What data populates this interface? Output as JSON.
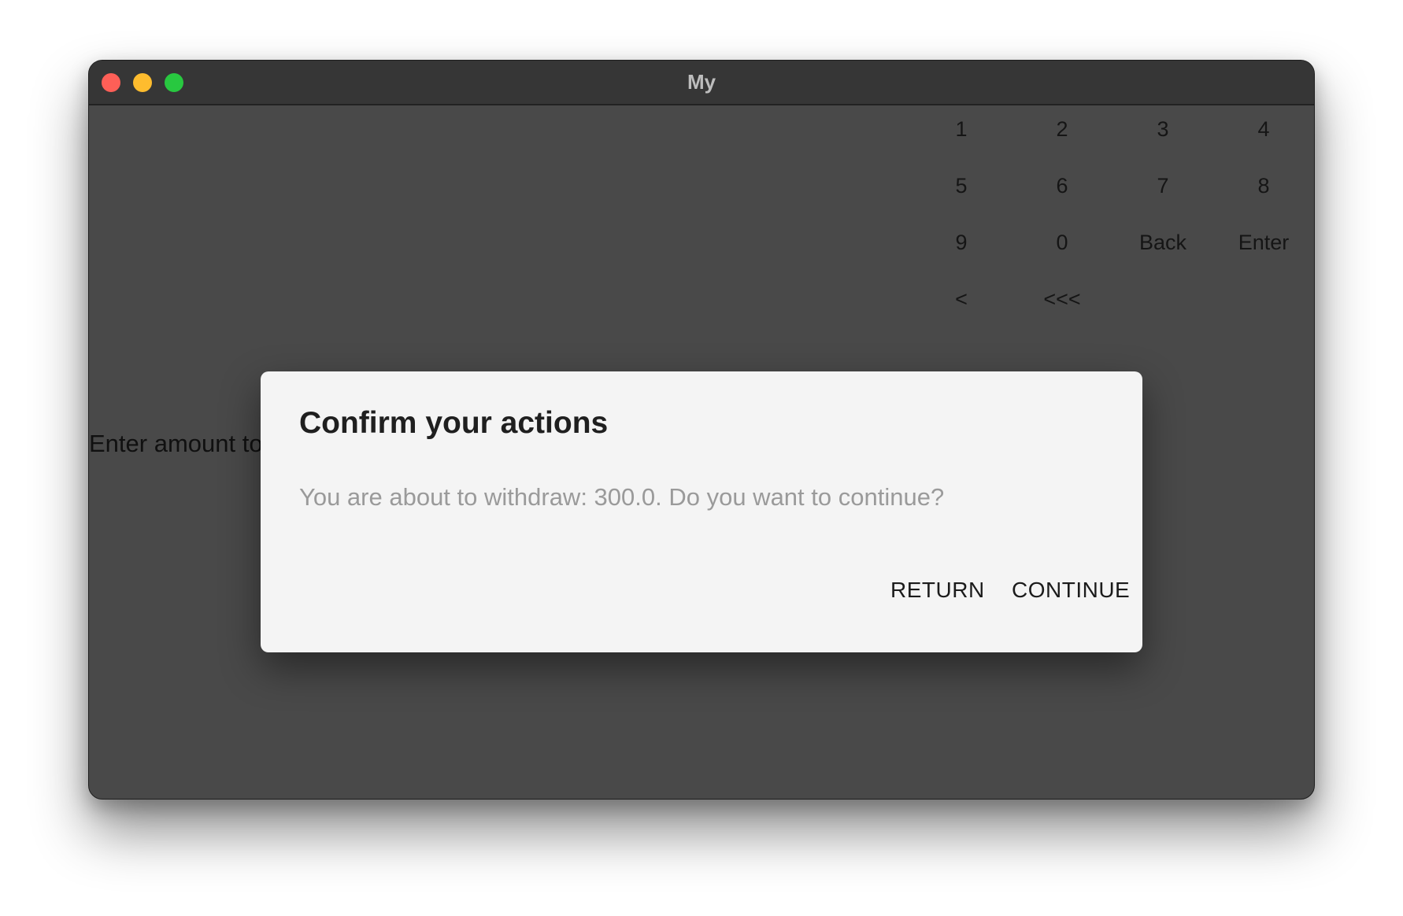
{
  "window": {
    "title": "My"
  },
  "keypad": {
    "keys": [
      "1",
      "2",
      "3",
      "4",
      "5",
      "6",
      "7",
      "8",
      "9",
      "0",
      "Back",
      "Enter",
      "<",
      "<<<"
    ]
  },
  "main": {
    "prompt": "Enter amount to"
  },
  "dialog": {
    "title": "Confirm your actions",
    "message": "You are about to withdraw: 300.0. Do you want to continue?",
    "return_label": "RETURN",
    "continue_label": "CONTINUE"
  },
  "colors": {
    "window_bg": "#4b4b4b",
    "titlebar_bg": "#363636",
    "dialog_bg": "#f4f4f4",
    "close": "#fe5f57",
    "minimize": "#febc2e",
    "maximize": "#28c840"
  }
}
